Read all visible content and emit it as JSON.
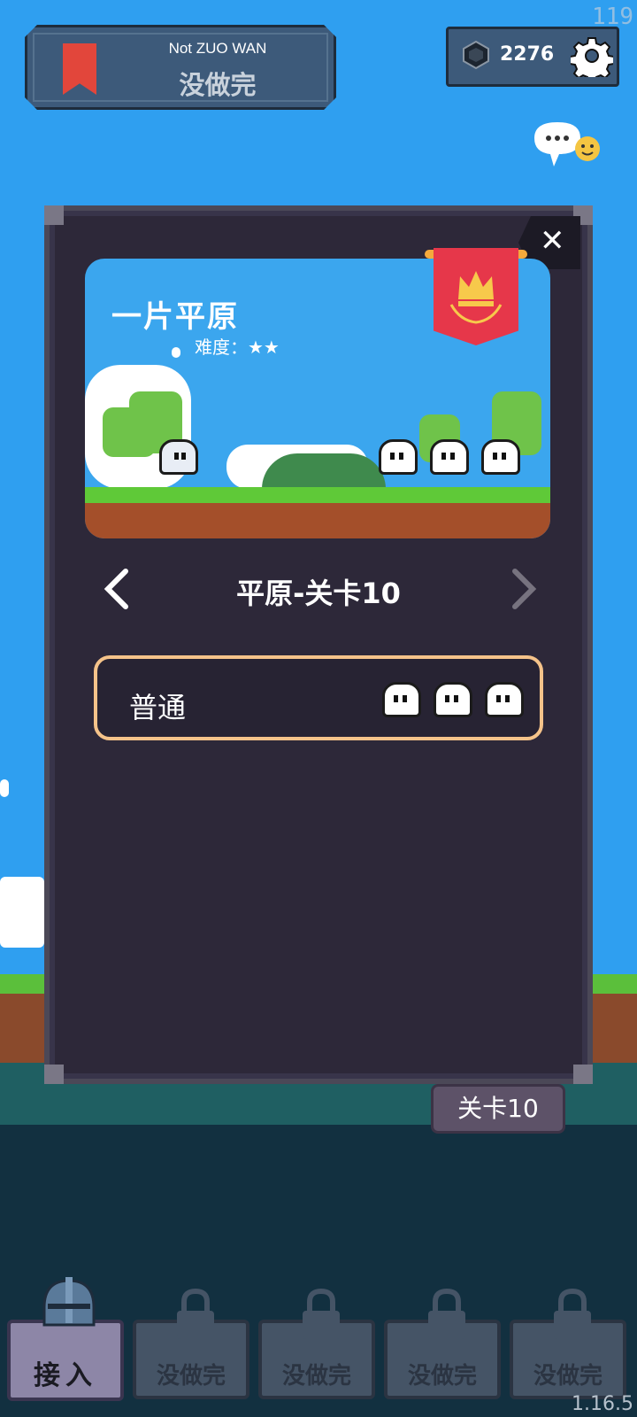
{
  "status": {
    "fps": "119",
    "version": "1.16.5"
  },
  "header": {
    "subtitle": "Not ZUO WAN",
    "title": "没做完",
    "currency_value": "2276"
  },
  "stage": {
    "scene_title": "一片平原",
    "difficulty_label": "难度：★★",
    "stage_name": "平原-关卡10",
    "mode_label": "普通",
    "level_tag": "关卡10"
  },
  "tabs": [
    {
      "label": "接入",
      "active": true
    },
    {
      "label": "没做完",
      "locked": true
    },
    {
      "label": "没做完",
      "locked": true
    },
    {
      "label": "没做完",
      "locked": true
    },
    {
      "label": "没做完",
      "locked": true
    }
  ],
  "colors": {
    "sky": "#2f9ff0",
    "panel": "#2d2839",
    "mode_border": "#f5c38a",
    "flag": "#e6374a"
  },
  "icons": [
    "bookmark-icon",
    "gem-icon",
    "gear-icon",
    "chat-icon",
    "close-icon",
    "crown-icon",
    "chevron-left-icon",
    "chevron-right-icon",
    "lock-icon",
    "helmet-icon"
  ]
}
